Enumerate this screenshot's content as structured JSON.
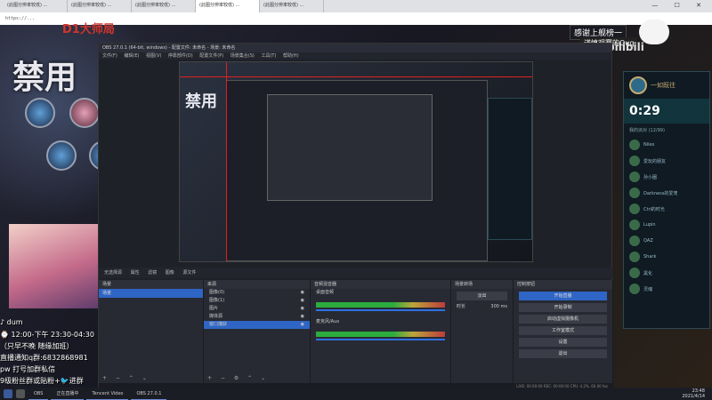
{
  "browser": {
    "tabs": [
      "(此图分辨率较低) ...",
      "(此图分辨率较低) ...",
      "(此图分辨率较低) ...",
      "(此图分辨率较低) ...",
      "(此图分辨率较低) ..."
    ],
    "address": "https://..."
  },
  "overlay_left": {
    "master_rank": "D1大师局",
    "banned_title": "禁用",
    "stream_lines": [
      "♪ dum",
      "⌚ 12:00-下午  23:30-04:30",
      "（只早不晚 随缘加班）",
      "直播通知q群:6832868981",
      "pw 打号加群私信",
      "9级粉丝群或贴粉+🐦进群"
    ]
  },
  "overlay_right": {
    "top_text": "感谢上舰榜一",
    "top_text2": "谨慎观赛的Quq",
    "bili_mark": "bilibili",
    "party": {
      "player": "一如既往",
      "timer": "0:29",
      "title": "我的派对 (12/99)",
      "members": [
        "Nilex",
        "爱玩的朋友",
        "孙小圈",
        "Darkness的爱宠",
        "Ctrl的时光",
        "Lupin",
        "QAZ",
        "Shark",
        "黑化",
        "灵魂"
      ]
    }
  },
  "obs": {
    "window_title": "OBS 27.0.1 (64-bit, windows) - 配置文件: 未命名 - 场景: 未命名",
    "menu": "文件(F) 编辑(E) 视图(V) 停靠部件(D) 配置文件(P) 场景集合(S) 工具(T) 帮助(H)",
    "toolbar": "无选择源  属性  滤镜  图像  源文件",
    "docks": {
      "scenes": {
        "title": "场景",
        "items": [
          "场景"
        ]
      },
      "sources": {
        "title": "来源",
        "items": [
          "图像(0)",
          "图像(1)",
          "图片",
          "媒体源",
          "窗口捕获"
        ]
      },
      "mixer": {
        "title": "音频混音器",
        "tracks": [
          "桌面音频",
          "麦克风/Aux"
        ]
      },
      "transitions": {
        "title": "场景转场",
        "select": "淡出",
        "duration_label": "时长",
        "duration": "300 ms"
      },
      "controls": {
        "title": "控制按钮",
        "buttons": [
          "开始直播",
          "开始录制",
          "启动虚拟摄像机",
          "工作室模式",
          "设置",
          "退出"
        ]
      }
    },
    "status": "LIVE: 00:00:00   REC: 00:00:00   CPU: 4.2%, 60.00 fps"
  },
  "taskbar": {
    "apps": [
      "OBS",
      "正在直播中",
      "Tencent Video",
      "OBS 27.0.1"
    ],
    "clock_time": "23:48",
    "clock_date": "2021/4/14"
  }
}
